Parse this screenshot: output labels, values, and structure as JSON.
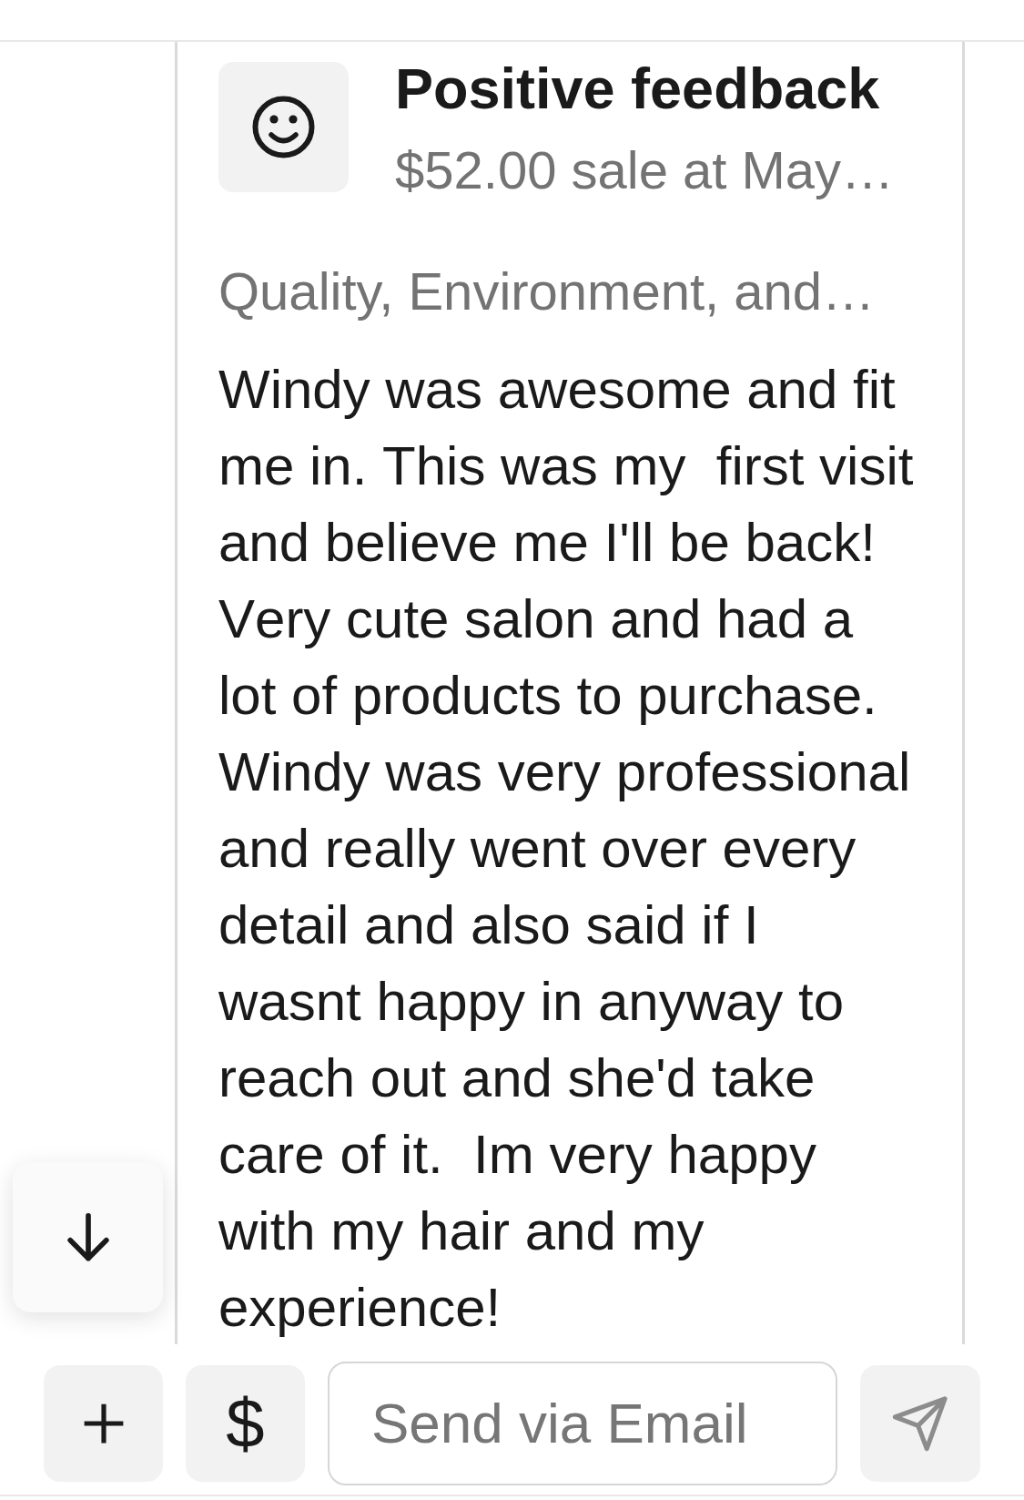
{
  "feedback_card": {
    "title": "Positive feedback",
    "subtitle": "$52.00 sale at May…",
    "categories": "Quality, Environment, and…",
    "review": "Windy was awesome and fit me in. This was my  first visit and believe me I'll be back! Very cute salon and had a lot of products to purchase. Windy was very professional and really went over every detail and also said if I wasnt happy in anyway to reach out and she'd take care of it.  Im very happy with my hair and my experience!"
  },
  "composer": {
    "currency_button": "$",
    "message_field": {
      "placeholder": "Send via Email"
    },
    "send_button": {
      "disabled": true
    }
  }
}
